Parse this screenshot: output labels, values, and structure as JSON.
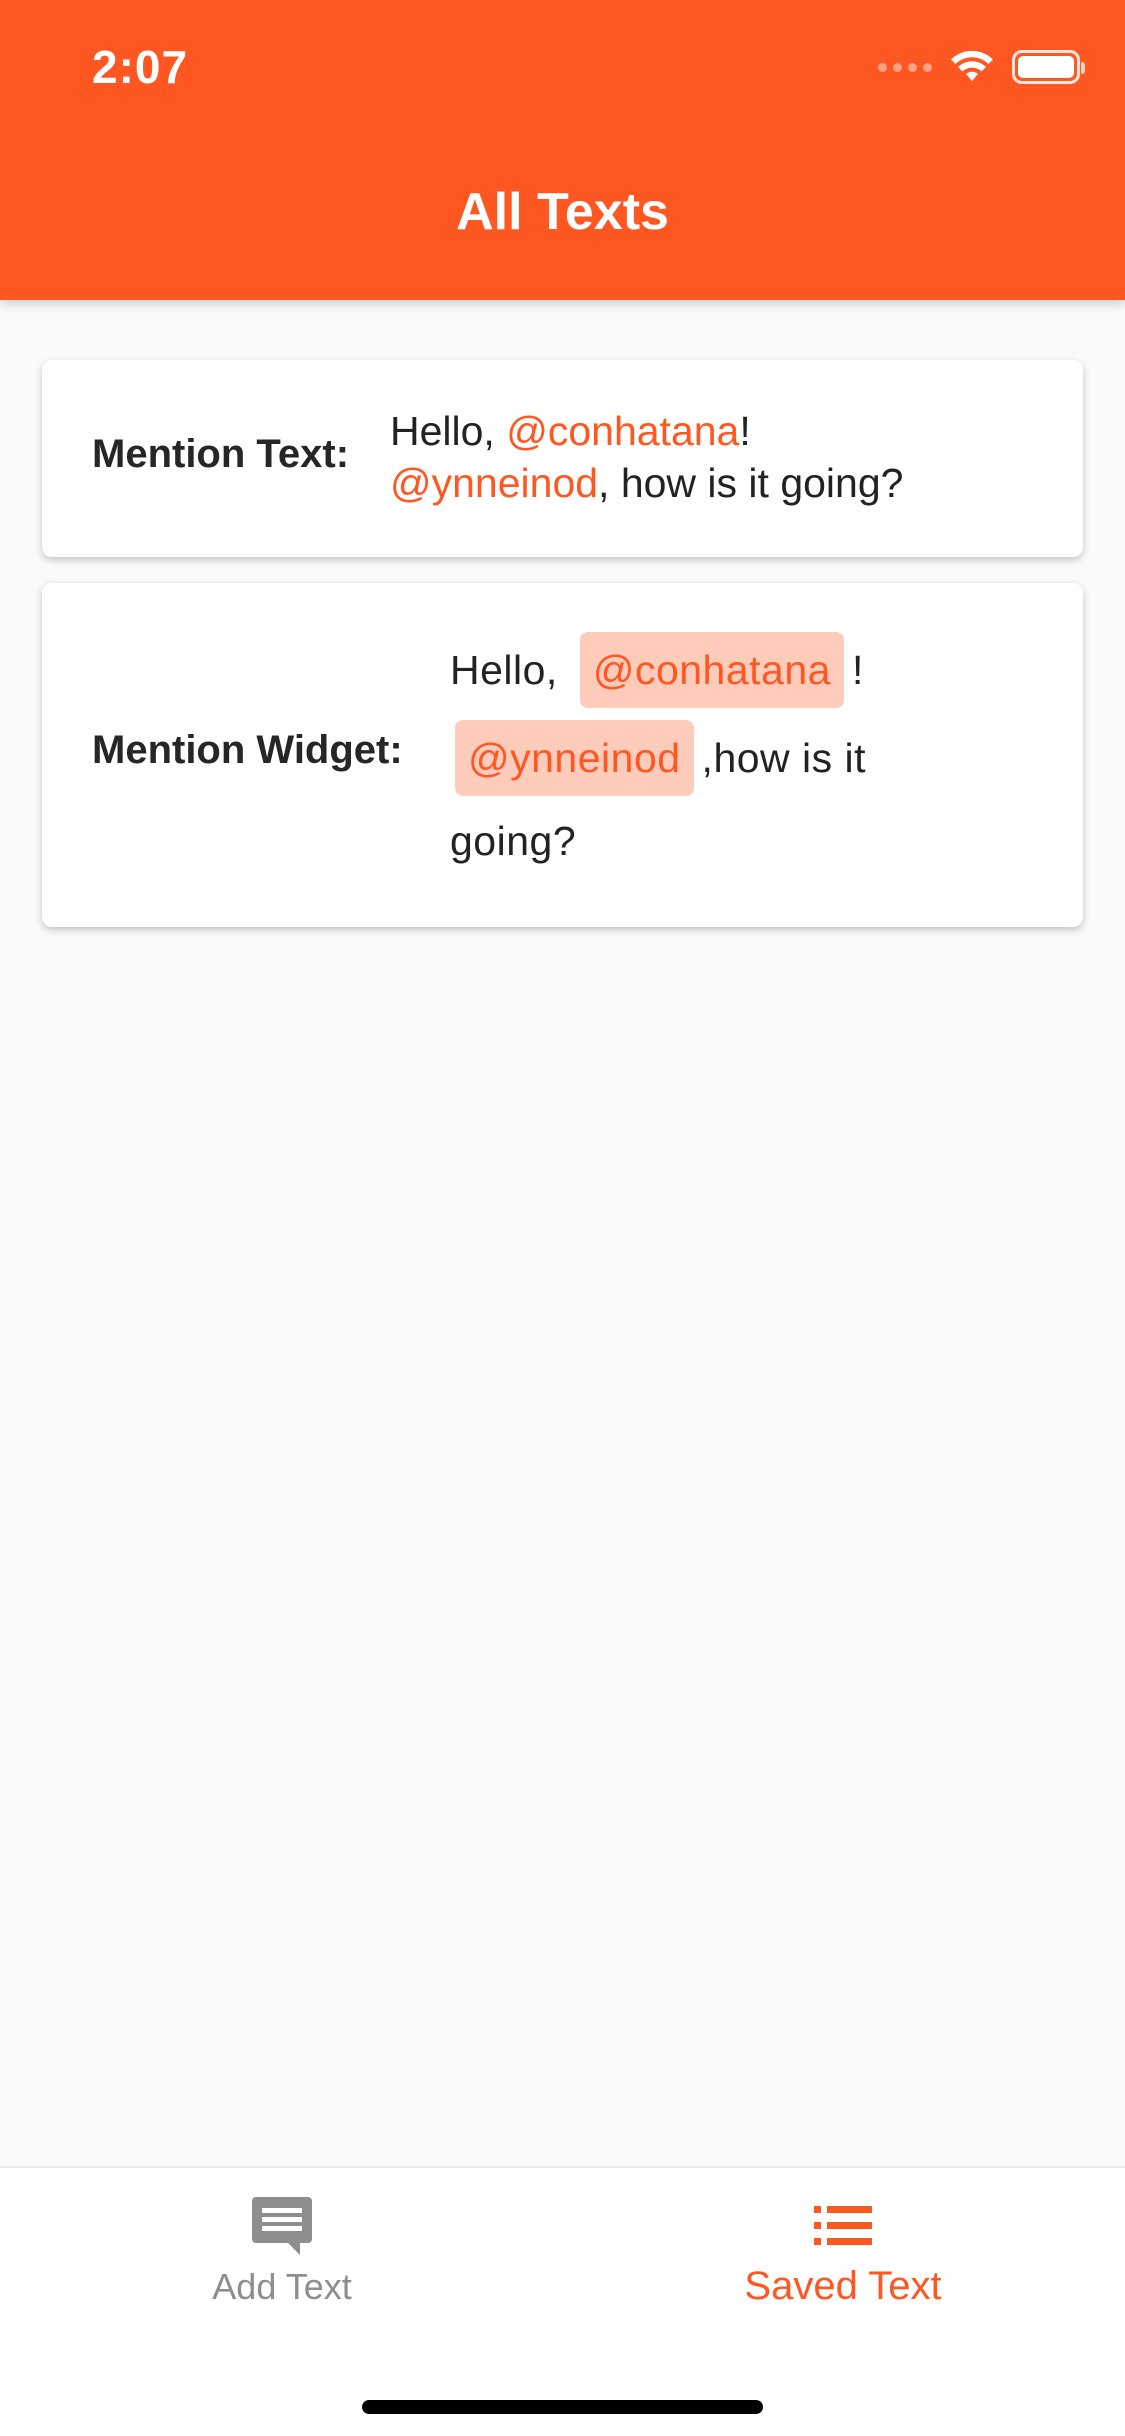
{
  "status_bar": {
    "time": "2:07",
    "signal_icon": "cellular-signal-icon",
    "wifi_icon": "wifi-icon",
    "battery_icon": "battery-icon"
  },
  "header": {
    "title": "All Texts",
    "background_color": "#ff5722"
  },
  "cards": {
    "mention_text": {
      "label": "Mention Text:",
      "greeting": "Hello, ",
      "mention_1": "@conhatana",
      "punct_1": "!",
      "mention_2": "@ynneinod",
      "rest": ", how is it going?"
    },
    "mention_widget": {
      "label": "Mention Widget:",
      "greeting": "Hello,",
      "mention_1": "@conhatana",
      "punct_1": "!",
      "mention_2": "@ynneinod",
      "rest_1": ",how is it",
      "rest_2": "going?"
    }
  },
  "bottom_nav": {
    "items": [
      {
        "label": "Add Text",
        "icon": "message-icon",
        "active": false
      },
      {
        "label": "Saved Text",
        "icon": "list-icon",
        "active": true
      }
    ]
  },
  "colors": {
    "accent": "#ff5722",
    "chip_background": "#ffccbc",
    "inactive": "#8e8e8e"
  }
}
